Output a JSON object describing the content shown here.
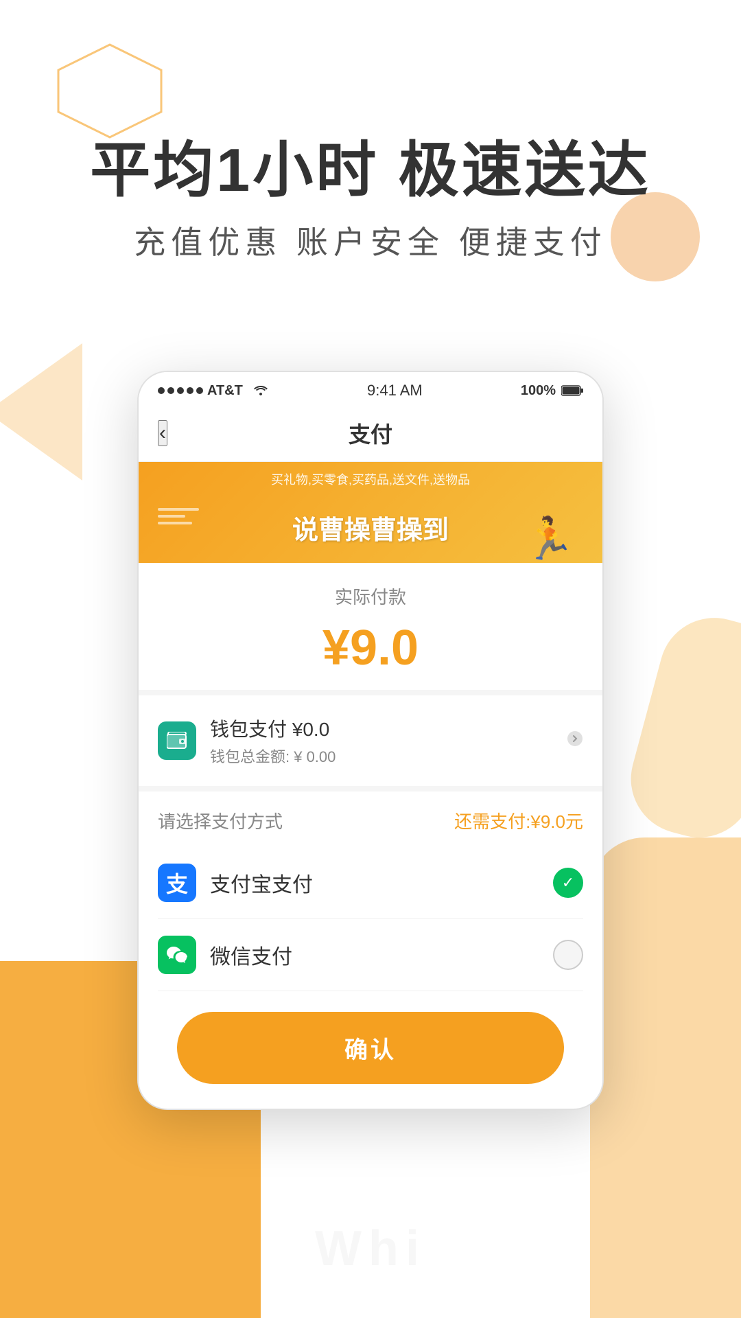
{
  "background": {
    "colors": {
      "primary": "#f5a020",
      "light": "#f5c08a",
      "white": "#ffffff"
    }
  },
  "hero": {
    "title": "平均1小时 极速送达",
    "subtitle": "充值优惠   账户安全   便捷支付"
  },
  "status_bar": {
    "carrier": "AT&T",
    "time": "9:41 AM",
    "battery": "100%"
  },
  "nav": {
    "back_label": "‹",
    "title": "支付"
  },
  "banner": {
    "small_text": "买礼物,买零食,买药品,送文件,送物品",
    "main_text": "说曹操曹操到"
  },
  "payment": {
    "label": "实际付款",
    "amount": "¥9.0"
  },
  "wallet": {
    "title": "钱包支付 ¥0.0",
    "balance": "钱包总金额: ¥ 0.00"
  },
  "method_section": {
    "header_left": "请选择支付方式",
    "header_right_prefix": "还需支付:",
    "header_right_amount": "¥9.0元",
    "methods": [
      {
        "id": "alipay",
        "name": "支付宝支付",
        "icon_label": "支",
        "selected": true
      },
      {
        "id": "wechat",
        "name": "微信支付",
        "icon_label": "微",
        "selected": false
      }
    ]
  },
  "confirm": {
    "label": "确认"
  },
  "watermark": {
    "text": "Whi"
  }
}
